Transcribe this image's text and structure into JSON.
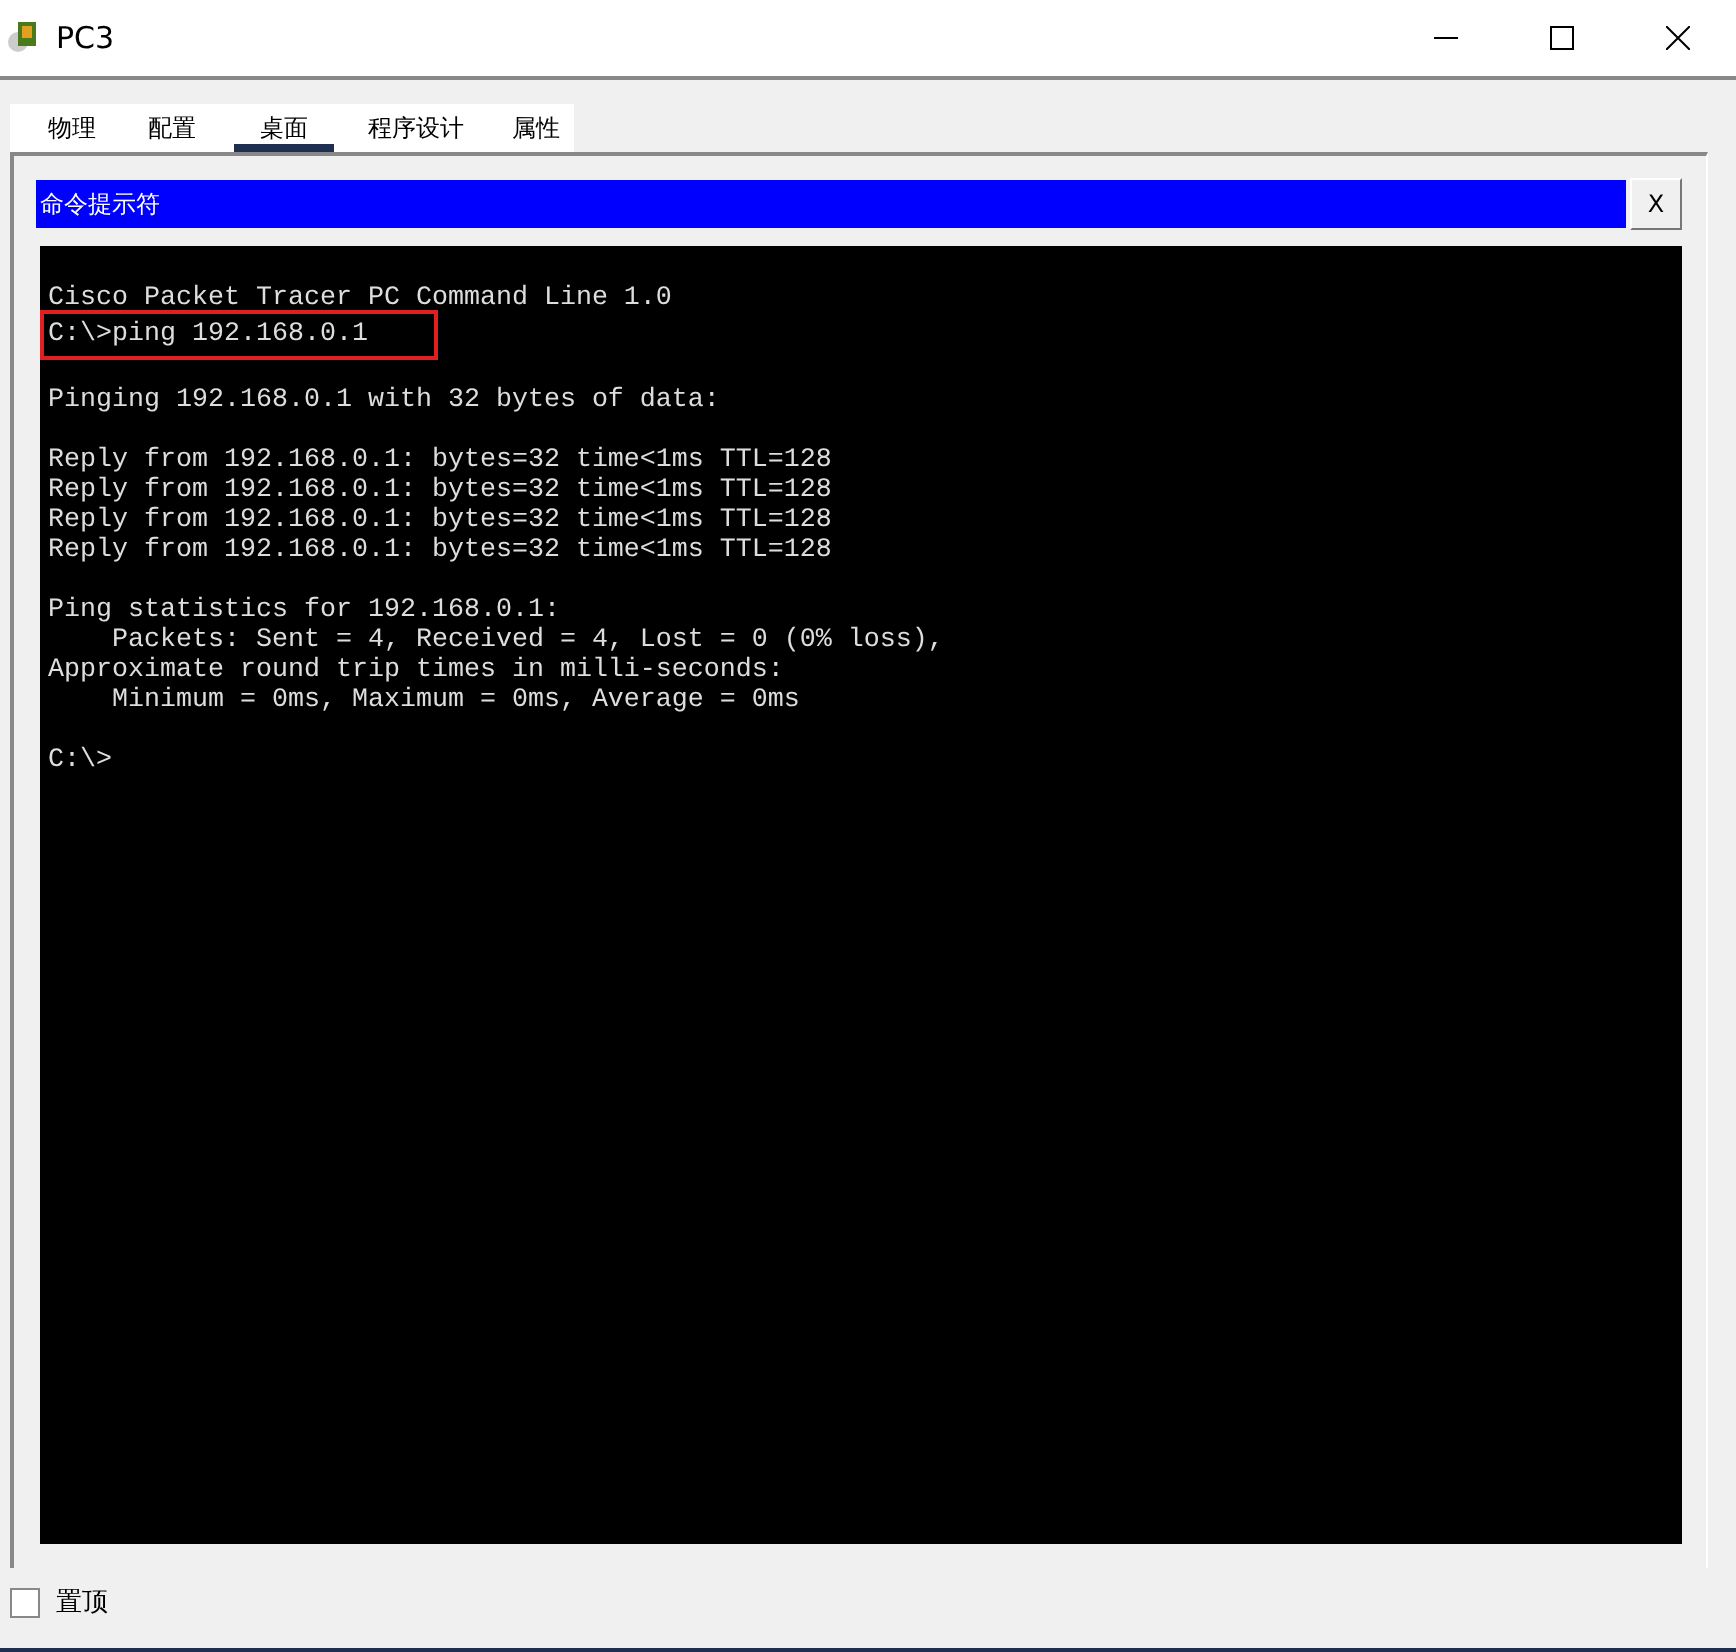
{
  "window": {
    "title": "PC3"
  },
  "tabs": [
    {
      "label": "物理",
      "selected": false
    },
    {
      "label": "配置",
      "selected": false
    },
    {
      "label": "桌面",
      "selected": true
    },
    {
      "label": "程序设计",
      "selected": false
    },
    {
      "label": "属性",
      "selected": false
    }
  ],
  "panel": {
    "title": "命令提示符",
    "close_label": "X"
  },
  "terminal": {
    "blocks": [
      [
        {
          "text": "Cisco Packet Tracer PC Command Line 1.0",
          "boxed": false
        },
        {
          "text": "C:\\>ping 192.168.0.1",
          "boxed": true
        }
      ],
      [
        {
          "text": "Pinging 192.168.0.1 with 32 bytes of data:",
          "boxed": false
        }
      ],
      [
        {
          "text": "Reply from 192.168.0.1: bytes=32 time<1ms TTL=128",
          "boxed": false
        },
        {
          "text": "Reply from 192.168.0.1: bytes=32 time<1ms TTL=128",
          "boxed": false
        },
        {
          "text": "Reply from 192.168.0.1: bytes=32 time<1ms TTL=128",
          "boxed": false
        },
        {
          "text": "Reply from 192.168.0.1: bytes=32 time<1ms TTL=128",
          "boxed": false
        }
      ],
      [
        {
          "text": "Ping statistics for 192.168.0.1:",
          "boxed": false
        },
        {
          "text": "    Packets: Sent = 4, Received = 4, Lost = 0 (0% loss),",
          "boxed": false
        },
        {
          "text": "Approximate round trip times in milli-seconds:",
          "boxed": false
        },
        {
          "text": "    Minimum = 0ms, Maximum = 0ms, Average = 0ms",
          "boxed": false
        }
      ],
      [
        {
          "text": "C:\\>",
          "boxed": false
        }
      ]
    ]
  },
  "always_on_top": {
    "label": "置顶",
    "checked": false
  }
}
